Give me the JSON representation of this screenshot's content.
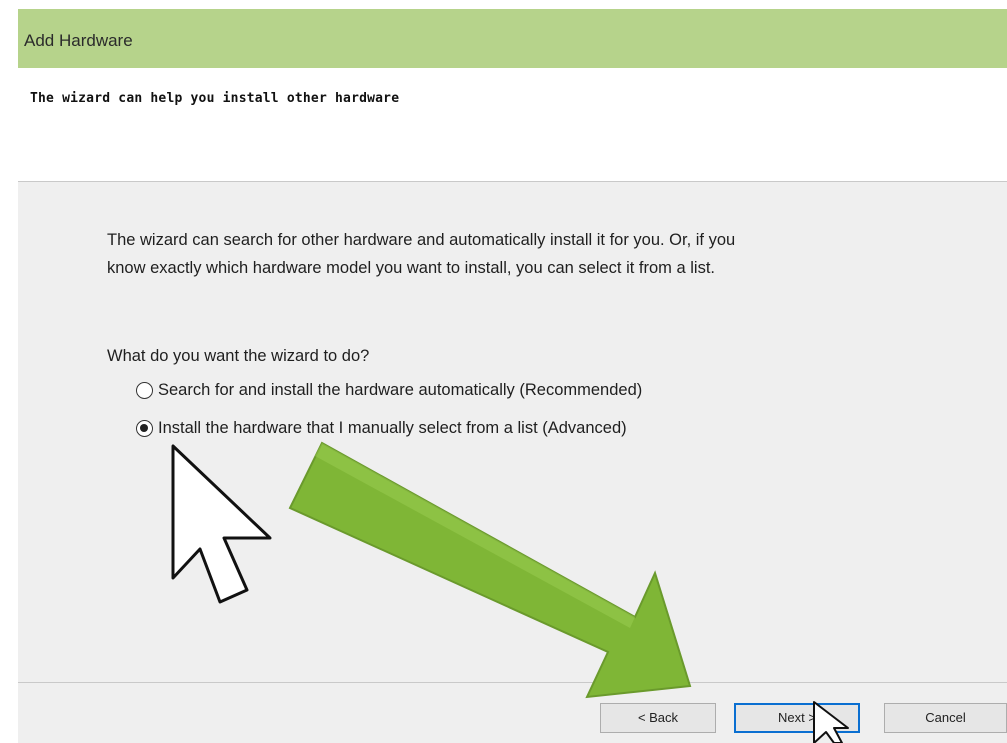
{
  "window": {
    "title": "Add Hardware"
  },
  "header": {
    "title": "The wizard can help you install other hardware"
  },
  "main": {
    "description_line1": "The wizard can search for other hardware and automatically install it for you. Or, if you",
    "description_line2": "know exactly which hardware model you want to install, you can select it from a list.",
    "question": "What do you want the wizard to do?",
    "options": [
      {
        "label": "Search for and install the hardware automatically (Recommended)",
        "selected": false
      },
      {
        "label": "Install the hardware that I manually select from a list (Advanced)",
        "selected": true
      }
    ]
  },
  "footer": {
    "back_label": "< Back",
    "next_label": "Next >",
    "cancel_label": "Cancel"
  },
  "colors": {
    "titlebar": "#b6d38b",
    "arrow_green": "#7fb636",
    "next_border": "#0a6fd1"
  },
  "annotations": {
    "arrow_icon": "green-arrow-icon",
    "pointer_icon": "mouse-pointer-icon"
  }
}
